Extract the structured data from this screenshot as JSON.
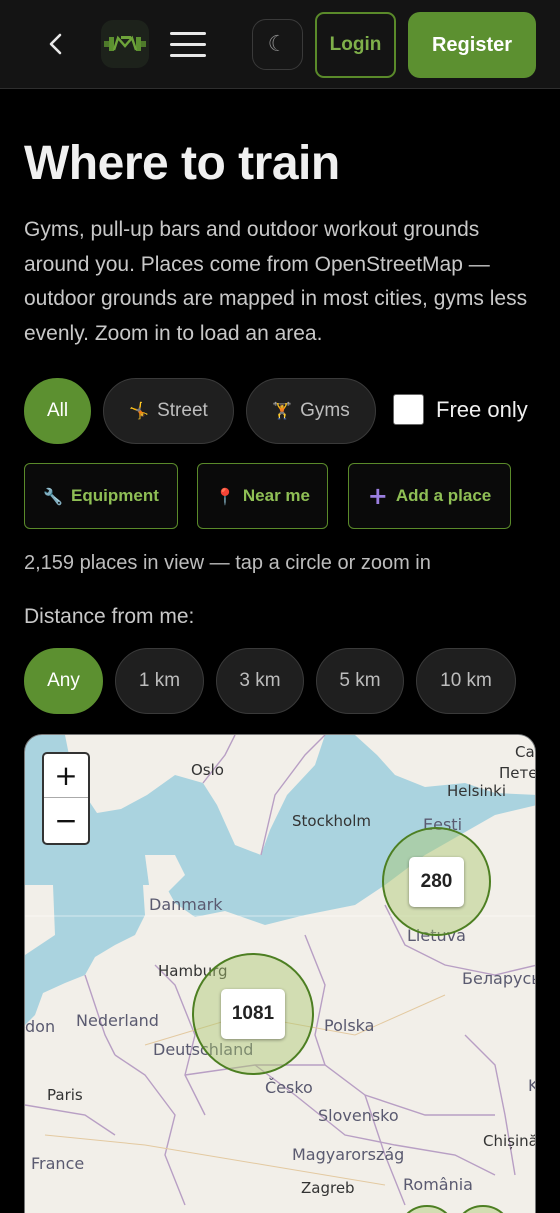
{
  "header": {
    "back_icon": "chevron-left-icon",
    "logo_icon": "barbell-logo-icon",
    "menu_icon": "hamburger-menu-icon",
    "theme_icon": "☾",
    "login_label": "Login",
    "register_label": "Register"
  },
  "page": {
    "title": "Where to train",
    "intro": "Gyms, pull-up bars and outdoor workout grounds around you. Places come from OpenStreetMap — outdoor grounds are mapped in most cities, gyms less evenly. Zoom in to load an area."
  },
  "filters": {
    "all_label": "All",
    "street_icon": "🤸",
    "street_label": "Street",
    "gyms_icon": "🏋",
    "gyms_label": "Gyms",
    "free_only_label": "Free only",
    "free_only_checked": false
  },
  "actions": {
    "equipment_icon": "🔧",
    "equipment_label": "Equipment",
    "near_me_icon": "📍",
    "near_me_label": "Near me",
    "add_place_icon": "+",
    "add_place_label": "Add a place"
  },
  "status": {
    "count_text": "2,159 places in view — tap a circle or zoom in"
  },
  "distance": {
    "label": "Distance from me:",
    "options": [
      "Any",
      "1 km",
      "3 km",
      "5 km",
      "10 km"
    ],
    "selected": "Any"
  },
  "map": {
    "zoom_in": "+",
    "zoom_out": "−",
    "cities": [
      "Oslo",
      "Helsinki",
      "Stockholm",
      "Hamburg",
      "Paris",
      "Zagreb",
      "Chișinău",
      "Ca",
      "Пете"
    ],
    "countries": [
      "Eesti",
      "Danmark",
      "Lietuva",
      "Беларусь",
      "Nederland",
      "Deutschland",
      "Polska",
      "Česko",
      "Slovensko",
      "Magyarország",
      "România",
      "France",
      "don",
      "K"
    ],
    "clusters": [
      {
        "count": "280"
      },
      {
        "count": "1081"
      }
    ],
    "colors": {
      "water": "#aad3df",
      "land": "#f2efe9",
      "border": "#b89fc4",
      "cluster": "#4d7f22"
    }
  }
}
